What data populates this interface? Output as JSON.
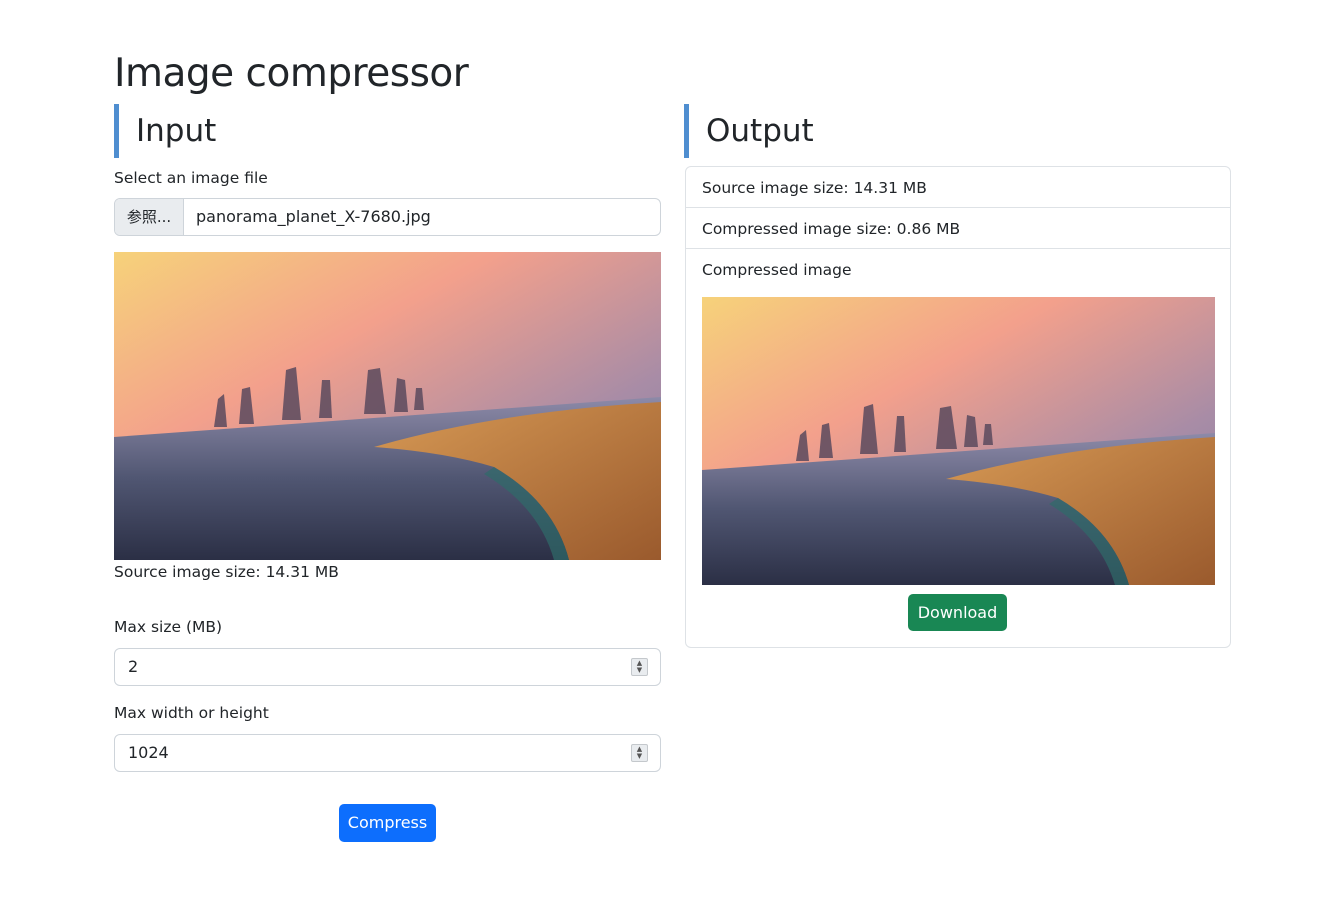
{
  "page": {
    "title": "Image compressor"
  },
  "input": {
    "heading": "Input",
    "file_label": "Select an image file",
    "file_button": "参照...",
    "file_name": "panorama_planet_X-7680.jpg",
    "source_size_text": "Source image size: 14.31 MB",
    "max_size_label": "Max size (MB)",
    "max_size_value": "2",
    "max_dim_label": "Max width or height",
    "max_dim_value": "1024",
    "compress_button": "Compress"
  },
  "output": {
    "heading": "Output",
    "source_size_text": "Source image size: 14.31 MB",
    "compressed_size_text": "Compressed image size: 0.86 MB",
    "compressed_image_label": "Compressed image",
    "download_button": "Download"
  },
  "colors": {
    "accent_border": "#4f8ed0",
    "primary_button": "#0d6efd",
    "success_button": "#198754"
  },
  "icons": {
    "spinner": "number-spinner-icon"
  }
}
